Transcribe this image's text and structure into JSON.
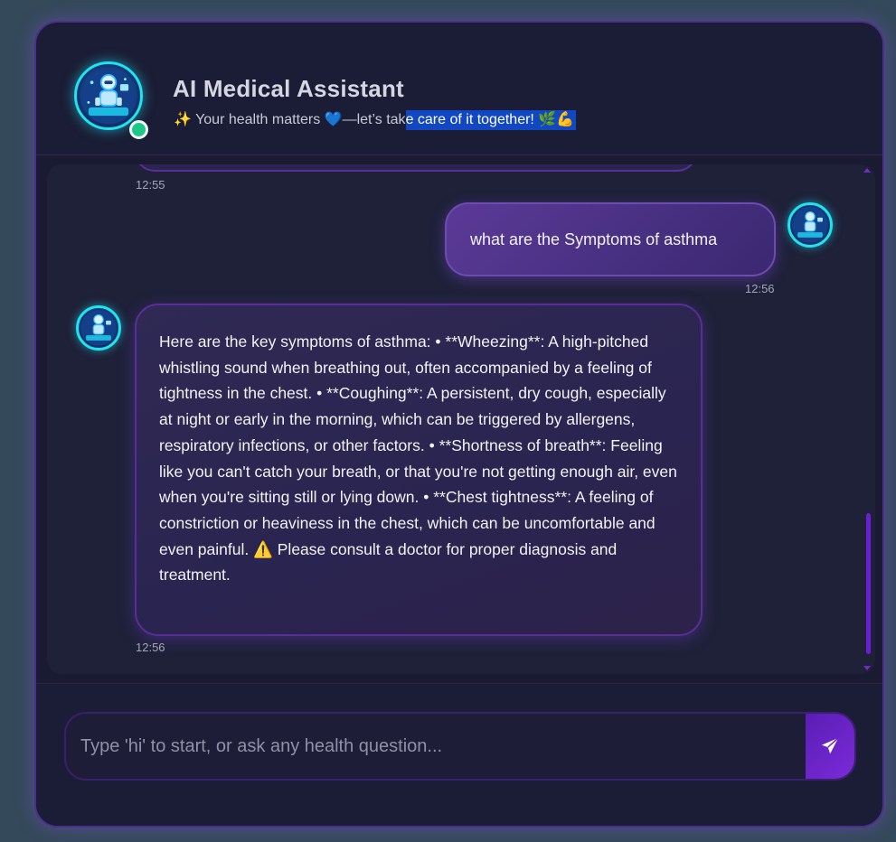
{
  "header": {
    "title": "AI Medical Assistant",
    "subtitle_before": "✨ Your health matters 💙—let’s tak",
    "subtitle_highlight": "e care of it together! 🌿💪"
  },
  "chat": {
    "messages": [
      {
        "sender": "bot",
        "time": "12:55"
      },
      {
        "sender": "user",
        "text": "what are the Symptoms of asthma",
        "time": "12:56"
      },
      {
        "sender": "bot",
        "text": "Here are the key symptoms of asthma: • **Wheezing**: A high-pitched whistling sound when breathing out, often accompanied by a feeling of tightness in the chest. • **Coughing**: A persistent, dry cough, especially at night or early in the morning, which can be triggered by allergens, respiratory infections, or other factors. • **Shortness of breath**: Feeling like you can't catch your breath, or that you're not getting enough air, even when you're sitting still or lying down. • **Chest tightness**: A feeling of constriction or heaviness in the chest, which can be uncomfortable and even painful. ⚠️ Please consult a doctor for proper diagnosis and treatment.",
        "time": "12:56"
      }
    ]
  },
  "composer": {
    "placeholder": "Type 'hi' to start, or ask any health question..."
  },
  "icons": {
    "avatar": "robot-doctor-avatar-icon",
    "send": "paper-plane-icon",
    "online": "online-status-dot"
  },
  "colors": {
    "accent": "#7a2bd8",
    "avatar_ring": "#1fe3f0",
    "online": "#1cc78a",
    "highlight": "#1147c2"
  }
}
